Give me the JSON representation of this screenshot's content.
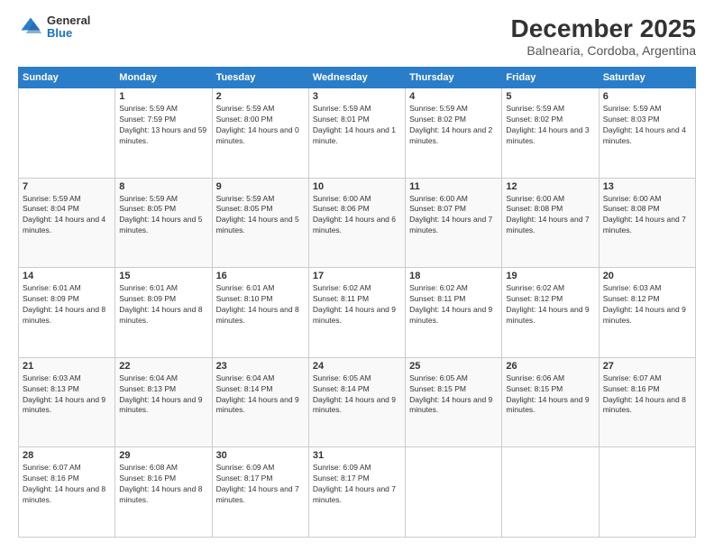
{
  "logo": {
    "general": "General",
    "blue": "Blue"
  },
  "title": "December 2025",
  "subtitle": "Balnearia, Cordoba, Argentina",
  "headers": [
    "Sunday",
    "Monday",
    "Tuesday",
    "Wednesday",
    "Thursday",
    "Friday",
    "Saturday"
  ],
  "weeks": [
    [
      {
        "day": "",
        "sunrise": "",
        "sunset": "",
        "daylight": ""
      },
      {
        "day": "1",
        "sunrise": "Sunrise: 5:59 AM",
        "sunset": "Sunset: 7:59 PM",
        "daylight": "Daylight: 13 hours and 59 minutes."
      },
      {
        "day": "2",
        "sunrise": "Sunrise: 5:59 AM",
        "sunset": "Sunset: 8:00 PM",
        "daylight": "Daylight: 14 hours and 0 minutes."
      },
      {
        "day": "3",
        "sunrise": "Sunrise: 5:59 AM",
        "sunset": "Sunset: 8:01 PM",
        "daylight": "Daylight: 14 hours and 1 minute."
      },
      {
        "day": "4",
        "sunrise": "Sunrise: 5:59 AM",
        "sunset": "Sunset: 8:02 PM",
        "daylight": "Daylight: 14 hours and 2 minutes."
      },
      {
        "day": "5",
        "sunrise": "Sunrise: 5:59 AM",
        "sunset": "Sunset: 8:02 PM",
        "daylight": "Daylight: 14 hours and 3 minutes."
      },
      {
        "day": "6",
        "sunrise": "Sunrise: 5:59 AM",
        "sunset": "Sunset: 8:03 PM",
        "daylight": "Daylight: 14 hours and 4 minutes."
      }
    ],
    [
      {
        "day": "7",
        "sunrise": "Sunrise: 5:59 AM",
        "sunset": "Sunset: 8:04 PM",
        "daylight": "Daylight: 14 hours and 4 minutes."
      },
      {
        "day": "8",
        "sunrise": "Sunrise: 5:59 AM",
        "sunset": "Sunset: 8:05 PM",
        "daylight": "Daylight: 14 hours and 5 minutes."
      },
      {
        "day": "9",
        "sunrise": "Sunrise: 5:59 AM",
        "sunset": "Sunset: 8:05 PM",
        "daylight": "Daylight: 14 hours and 5 minutes."
      },
      {
        "day": "10",
        "sunrise": "Sunrise: 6:00 AM",
        "sunset": "Sunset: 8:06 PM",
        "daylight": "Daylight: 14 hours and 6 minutes."
      },
      {
        "day": "11",
        "sunrise": "Sunrise: 6:00 AM",
        "sunset": "Sunset: 8:07 PM",
        "daylight": "Daylight: 14 hours and 7 minutes."
      },
      {
        "day": "12",
        "sunrise": "Sunrise: 6:00 AM",
        "sunset": "Sunset: 8:08 PM",
        "daylight": "Daylight: 14 hours and 7 minutes."
      },
      {
        "day": "13",
        "sunrise": "Sunrise: 6:00 AM",
        "sunset": "Sunset: 8:08 PM",
        "daylight": "Daylight: 14 hours and 7 minutes."
      }
    ],
    [
      {
        "day": "14",
        "sunrise": "Sunrise: 6:01 AM",
        "sunset": "Sunset: 8:09 PM",
        "daylight": "Daylight: 14 hours and 8 minutes."
      },
      {
        "day": "15",
        "sunrise": "Sunrise: 6:01 AM",
        "sunset": "Sunset: 8:09 PM",
        "daylight": "Daylight: 14 hours and 8 minutes."
      },
      {
        "day": "16",
        "sunrise": "Sunrise: 6:01 AM",
        "sunset": "Sunset: 8:10 PM",
        "daylight": "Daylight: 14 hours and 8 minutes."
      },
      {
        "day": "17",
        "sunrise": "Sunrise: 6:02 AM",
        "sunset": "Sunset: 8:11 PM",
        "daylight": "Daylight: 14 hours and 9 minutes."
      },
      {
        "day": "18",
        "sunrise": "Sunrise: 6:02 AM",
        "sunset": "Sunset: 8:11 PM",
        "daylight": "Daylight: 14 hours and 9 minutes."
      },
      {
        "day": "19",
        "sunrise": "Sunrise: 6:02 AM",
        "sunset": "Sunset: 8:12 PM",
        "daylight": "Daylight: 14 hours and 9 minutes."
      },
      {
        "day": "20",
        "sunrise": "Sunrise: 6:03 AM",
        "sunset": "Sunset: 8:12 PM",
        "daylight": "Daylight: 14 hours and 9 minutes."
      }
    ],
    [
      {
        "day": "21",
        "sunrise": "Sunrise: 6:03 AM",
        "sunset": "Sunset: 8:13 PM",
        "daylight": "Daylight: 14 hours and 9 minutes."
      },
      {
        "day": "22",
        "sunrise": "Sunrise: 6:04 AM",
        "sunset": "Sunset: 8:13 PM",
        "daylight": "Daylight: 14 hours and 9 minutes."
      },
      {
        "day": "23",
        "sunrise": "Sunrise: 6:04 AM",
        "sunset": "Sunset: 8:14 PM",
        "daylight": "Daylight: 14 hours and 9 minutes."
      },
      {
        "day": "24",
        "sunrise": "Sunrise: 6:05 AM",
        "sunset": "Sunset: 8:14 PM",
        "daylight": "Daylight: 14 hours and 9 minutes."
      },
      {
        "day": "25",
        "sunrise": "Sunrise: 6:05 AM",
        "sunset": "Sunset: 8:15 PM",
        "daylight": "Daylight: 14 hours and 9 minutes."
      },
      {
        "day": "26",
        "sunrise": "Sunrise: 6:06 AM",
        "sunset": "Sunset: 8:15 PM",
        "daylight": "Daylight: 14 hours and 9 minutes."
      },
      {
        "day": "27",
        "sunrise": "Sunrise: 6:07 AM",
        "sunset": "Sunset: 8:16 PM",
        "daylight": "Daylight: 14 hours and 8 minutes."
      }
    ],
    [
      {
        "day": "28",
        "sunrise": "Sunrise: 6:07 AM",
        "sunset": "Sunset: 8:16 PM",
        "daylight": "Daylight: 14 hours and 8 minutes."
      },
      {
        "day": "29",
        "sunrise": "Sunrise: 6:08 AM",
        "sunset": "Sunset: 8:16 PM",
        "daylight": "Daylight: 14 hours and 8 minutes."
      },
      {
        "day": "30",
        "sunrise": "Sunrise: 6:09 AM",
        "sunset": "Sunset: 8:17 PM",
        "daylight": "Daylight: 14 hours and 7 minutes."
      },
      {
        "day": "31",
        "sunrise": "Sunrise: 6:09 AM",
        "sunset": "Sunset: 8:17 PM",
        "daylight": "Daylight: 14 hours and 7 minutes."
      },
      {
        "day": "",
        "sunrise": "",
        "sunset": "",
        "daylight": ""
      },
      {
        "day": "",
        "sunrise": "",
        "sunset": "",
        "daylight": ""
      },
      {
        "day": "",
        "sunrise": "",
        "sunset": "",
        "daylight": ""
      }
    ]
  ]
}
